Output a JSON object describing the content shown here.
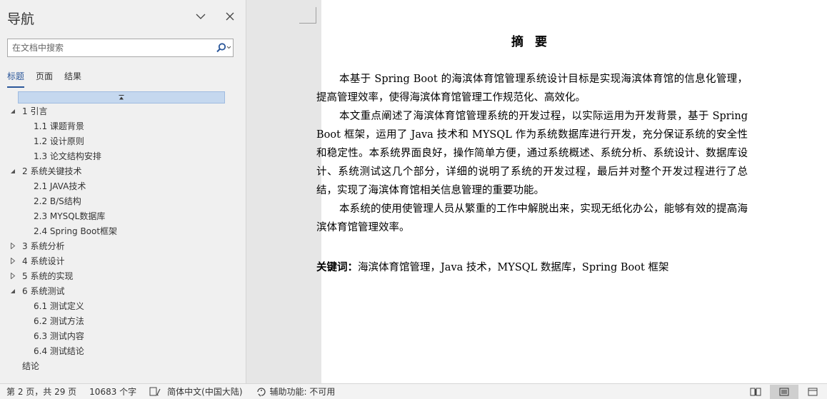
{
  "nav": {
    "title": "导航",
    "search_placeholder": "在文档中搜索",
    "tabs": [
      {
        "label": "标题",
        "active": true
      },
      {
        "label": "页面",
        "active": false
      },
      {
        "label": "结果",
        "active": false
      }
    ],
    "tree": [
      {
        "label": "1 引言",
        "level": 1,
        "state": "expanded"
      },
      {
        "label": "1.1 课题背景",
        "level": 2
      },
      {
        "label": "1.2 设计原则",
        "level": 2
      },
      {
        "label": "1.3 论文结构安排",
        "level": 2
      },
      {
        "label": "2 系统关键技术",
        "level": 1,
        "state": "expanded"
      },
      {
        "label": "2.1 JAVA技术",
        "level": 2
      },
      {
        "label": "2.2 B/S结构",
        "level": 2
      },
      {
        "label": "2.3 MYSQL数据库",
        "level": 2
      },
      {
        "label": "2.4 Spring Boot框架",
        "level": 2
      },
      {
        "label": "3 系统分析",
        "level": 1,
        "state": "collapsed"
      },
      {
        "label": "4 系统设计",
        "level": 1,
        "state": "collapsed"
      },
      {
        "label": "5 系统的实现",
        "level": 1,
        "state": "collapsed"
      },
      {
        "label": "6 系统测试",
        "level": 1,
        "state": "expanded"
      },
      {
        "label": "6.1 测试定义",
        "level": 2
      },
      {
        "label": "6.2 测试方法",
        "level": 2
      },
      {
        "label": "6.3 测试内容",
        "level": 2
      },
      {
        "label": "6.4 测试结论",
        "level": 2
      },
      {
        "label": "结论",
        "level": 1,
        "state": "none"
      }
    ]
  },
  "document": {
    "title": "摘要",
    "paragraphs": [
      "本基于 Spring Boot 的海滨体育馆管理系统设计目标是实现海滨体育馆的信息化管理，提高管理效率，使得海滨体育馆管理工作规范化、高效化。",
      "本文重点阐述了海滨体育馆管理系统的开发过程，以实际运用为开发背景，基于 Spring Boot 框架，运用了 Java 技术和 MYSQL 作为系统数据库进行开发，充分保证系统的安全性和稳定性。本系统界面良好，操作简单方便，通过系统概述、系统分析、系统设计、数据库设计、系统测试这几个部分，详细的说明了系统的开发过程，最后并对整个开发过程进行了总结，实现了海滨体育馆相关信息管理的重要功能。",
      "本系统的使用使管理人员从繁重的工作中解脱出来，实现无纸化办公，能够有效的提高海滨体育馆管理效率。"
    ],
    "keywords_label": "关键词：",
    "keywords": "海滨体育馆管理，Java 技术，MYSQL 数据库，Spring Boot 框架"
  },
  "status": {
    "page": "第 2 页，共 29 页",
    "words": "10683 个字",
    "language": "简体中文(中国大陆)",
    "accessibility": "辅助功能: 不可用"
  },
  "colors": {
    "accent": "#2b579a",
    "collapse_bar": "#c5d8ef"
  }
}
